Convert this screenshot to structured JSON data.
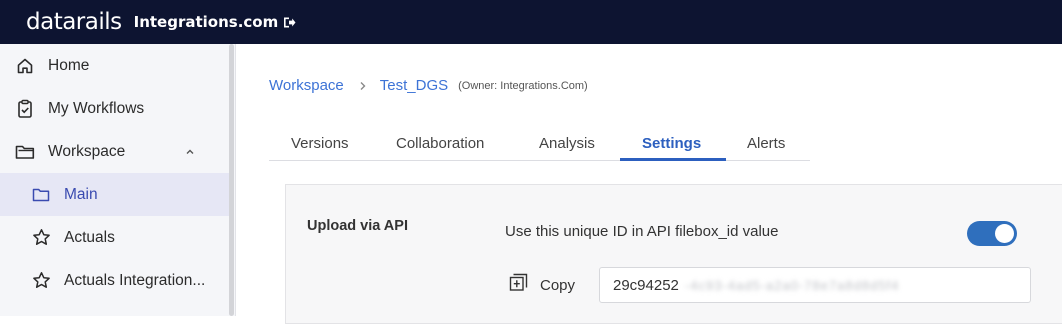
{
  "header": {
    "logo_text": "datarails",
    "company": "Integrations.com",
    "icons": {
      "logout": "logout-icon"
    },
    "background_color": "#0d1431"
  },
  "sidebar": {
    "items": [
      {
        "label": "Home",
        "icon": "home-icon"
      },
      {
        "label": "My Workflows",
        "icon": "clipboard-check-icon"
      },
      {
        "label": "Workspace",
        "icon": "folder-icon",
        "expanded": true
      },
      {
        "label": "Main",
        "icon": "folder-outline-icon",
        "active": true
      },
      {
        "label": "Actuals",
        "icon": "star-icon"
      },
      {
        "label": "Actuals Integration...",
        "icon": "star-icon"
      }
    ]
  },
  "breadcrumb": {
    "workspace": "Workspace",
    "file": "Test_DGS",
    "owner": "(Owner: Integrations.Com)"
  },
  "tabs": [
    {
      "label": "Versions"
    },
    {
      "label": "Collaboration"
    },
    {
      "label": "Analysis"
    },
    {
      "label": "Settings",
      "active": true
    },
    {
      "label": "Alerts"
    }
  ],
  "settings": {
    "upload_title": "Upload via API",
    "description": "Use this unique ID in API filebox_id value",
    "toggle_on": true,
    "copy_label": "Copy",
    "id_prefix": "29c94252",
    "id_redacted": "-4c93-4ad5-a2a0-78e7a8d8d5f4",
    "accent_color": "#2f6fbd"
  }
}
